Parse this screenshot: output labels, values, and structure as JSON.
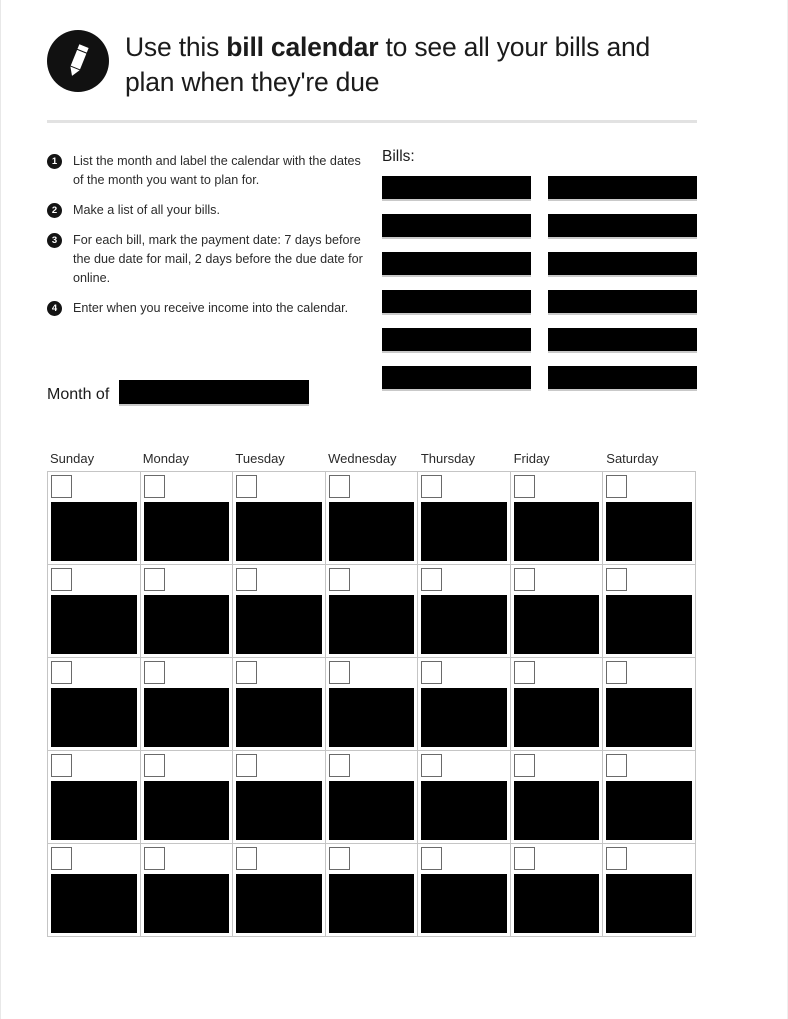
{
  "header": {
    "icon": "pencil-icon",
    "title_prefix": "Use this ",
    "title_bold": "bill calendar",
    "title_suffix": " to see all your bills and plan when they're due"
  },
  "instructions": {
    "steps": [
      {
        "number": "1",
        "text": "List the month and label the calendar with the dates of the month you want to plan for."
      },
      {
        "number": "2",
        "text": "Make a list of all your bills."
      },
      {
        "number": "3",
        "text": "For each bill, mark the payment date: 7 days before the due date for mail, 2 days before the due date for online."
      },
      {
        "number": "4",
        "text": "Enter when you receive income into the calendar."
      }
    ]
  },
  "month": {
    "label": "Month of",
    "value": ""
  },
  "bills": {
    "label": "Bills:",
    "rows": 6,
    "columns": 2,
    "entries": [
      "",
      "",
      "",
      "",
      "",
      "",
      "",
      "",
      "",
      "",
      "",
      ""
    ]
  },
  "calendar": {
    "weekdays": [
      "Sunday",
      "Monday",
      "Tuesday",
      "Wednesday",
      "Thursday",
      "Friday",
      "Saturday"
    ],
    "weeks": 5,
    "dates": [
      [
        "",
        "",
        "",
        "",
        "",
        "",
        ""
      ],
      [
        "",
        "",
        "",
        "",
        "",
        "",
        ""
      ],
      [
        "",
        "",
        "",
        "",
        "",
        "",
        ""
      ],
      [
        "",
        "",
        "",
        "",
        "",
        "",
        ""
      ],
      [
        "",
        "",
        "",
        "",
        "",
        "",
        ""
      ]
    ]
  },
  "colors": {
    "ink": "#000000",
    "text": "#1b1b1b",
    "rule": "#c5c5c5",
    "divider": "#e2e2e2"
  }
}
